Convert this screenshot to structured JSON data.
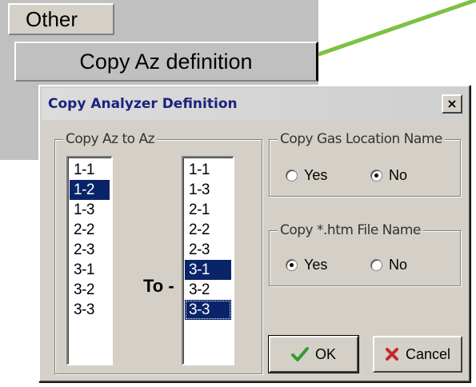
{
  "menu": {
    "tab_label": "Other",
    "item_label": "Copy Az definition"
  },
  "dialog": {
    "title": "Copy Analyzer Definition",
    "close_label": "×",
    "copy_az_group": {
      "caption": "Copy Az to Az",
      "from_items": [
        "1-1",
        "1-2",
        "1-3",
        "2-2",
        "2-3",
        "3-1",
        "3-2",
        "3-3"
      ],
      "from_selected": [
        "1-2"
      ],
      "to_label": "To -",
      "to_items": [
        "1-1",
        "1-3",
        "2-1",
        "2-2",
        "2-3",
        "3-1",
        "3-2",
        "3-3"
      ],
      "to_selected": [
        "3-1",
        "3-3"
      ]
    },
    "gas_group": {
      "caption": "Copy Gas Location Name",
      "yes_label": "Yes",
      "no_label": "No",
      "selected": "No"
    },
    "htm_group": {
      "caption": "Copy *.htm File Name",
      "yes_label": "Yes",
      "no_label": "No",
      "selected": "Yes"
    },
    "ok_label": "OK",
    "cancel_label": "Cancel"
  },
  "colors": {
    "selection": "#0a246a",
    "arrow": "#7cc242",
    "ok_check": "#2e9e2e",
    "cancel_x": "#c62828"
  }
}
